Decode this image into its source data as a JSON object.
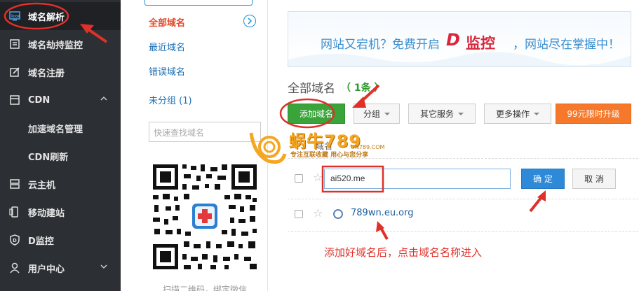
{
  "sidebar": {
    "items": [
      {
        "label": "域名解析",
        "icon": "monitor-icon",
        "active": true
      },
      {
        "label": "域名劫持监控",
        "icon": "clipboard-icon"
      },
      {
        "label": "域名注册",
        "icon": "edit-icon"
      },
      {
        "label": "CDN",
        "icon": "window-icon",
        "expanded": true
      },
      {
        "label": "加速域名管理",
        "sub": true
      },
      {
        "label": "CDN刷新",
        "sub": true
      },
      {
        "label": "云主机",
        "icon": "server-icon"
      },
      {
        "label": "移动建站",
        "icon": "mobile-icon"
      },
      {
        "label": "D监控",
        "icon": "shield-icon"
      },
      {
        "label": "用户中心",
        "icon": "user-icon"
      }
    ]
  },
  "domain_groups": {
    "items": [
      {
        "label": "全部域名",
        "active": true
      },
      {
        "label": "最近域名"
      },
      {
        "label": "错误域名"
      },
      {
        "label": "未分组 (1)"
      }
    ],
    "search_placeholder": "快速查找域名",
    "qr_caption": "扫描二维码，绑定微信"
  },
  "banner": {
    "text_left": "网站又宕机？免费开启",
    "d_letter": "D",
    "brand": "监控",
    "text_right": "，网站尽在掌握中！"
  },
  "main": {
    "title": "全部域名",
    "count": "（ 1条 ）",
    "buttons": {
      "add_domain": "添加域名",
      "group": "分组",
      "other_services": "其它服务",
      "more_actions": "更多操作",
      "upgrade": "99元限时升级"
    },
    "column_domain": "域名",
    "edit_value": "ai520.me",
    "ok": "确 定",
    "cancel": "取 消",
    "domain_row": "789wn.eu.org"
  },
  "annotation": {
    "text": "添加好域名后，点击域名名称进入"
  },
  "watermark": {
    "brand": "蜗牛789",
    "url": "UN789.COM",
    "slogan": "专注互联收藏  用心与您分享"
  },
  "colors": {
    "sidebar_bg": "#2c2f33",
    "accent_blue": "#2e8ad8",
    "green": "#3aa33a",
    "orange": "#f5782b",
    "annotation_red": "#e0302a"
  }
}
